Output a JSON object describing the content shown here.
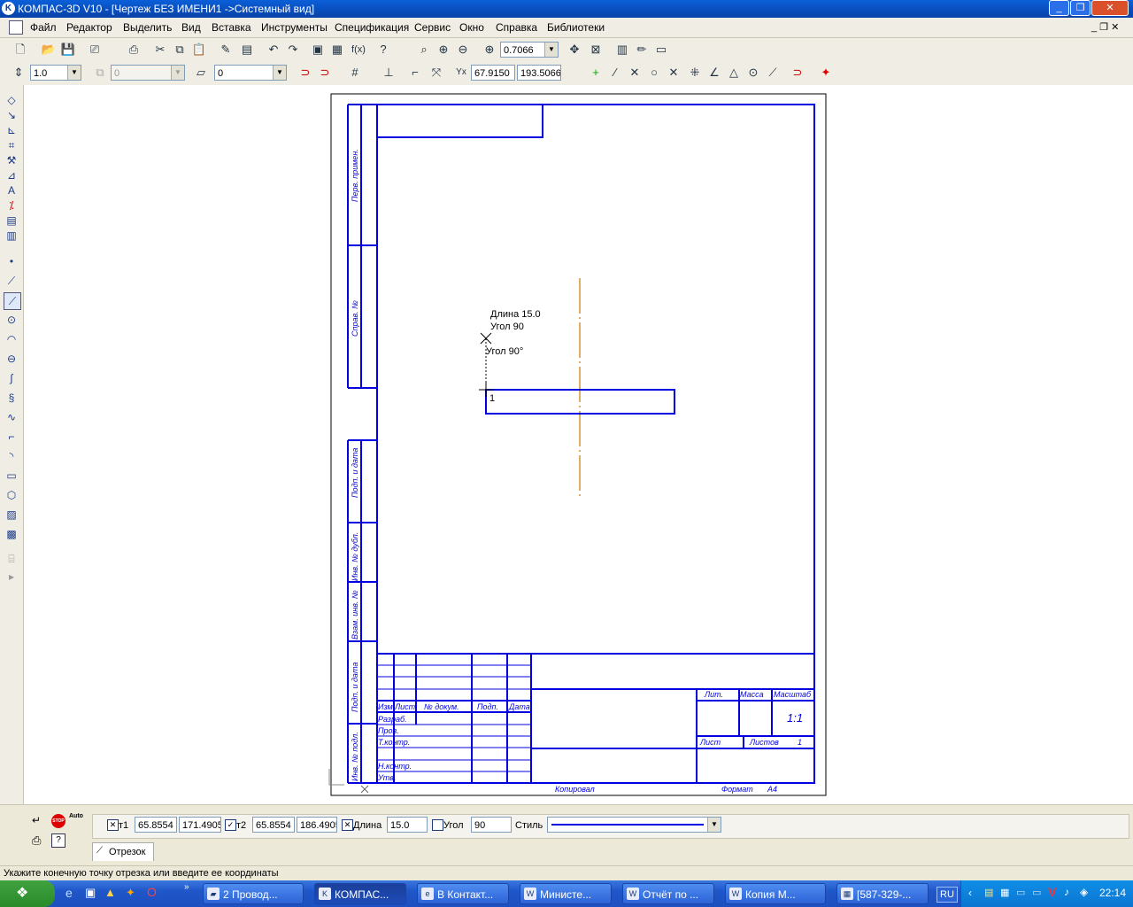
{
  "window": {
    "title": "КОМПАС-3D V10 - [Чертеж БЕЗ ИМЕНИ1 ->Системный вид]"
  },
  "menu": [
    "Файл",
    "Редактор",
    "Выделить",
    "Вид",
    "Вставка",
    "Инструменты",
    "Спецификация",
    "Сервис",
    "Окно",
    "Справка",
    "Библиотеки"
  ],
  "toolbar": {
    "zoom_value": "0.7066",
    "line_step": "1.0",
    "layer_combo": "0",
    "layer_value": "0",
    "coord_x": "67.9150",
    "coord_y": "193.5066"
  },
  "drawing": {
    "stamp_left": [
      "Перв. примен.",
      "Справ. №",
      "Подп. и дата",
      "Инв. № дубл.",
      "Взам. инв. №",
      "Подп. и дата",
      "Инв. № подл."
    ],
    "stamp_headers": [
      "Изм",
      "Лист",
      "№ докум.",
      "Подп.",
      "Дата"
    ],
    "stamp_rows": [
      "Разраб.",
      "Пров.",
      "Т.контр.",
      "Н.контр.",
      "Утв."
    ],
    "stamp_right_headers": [
      "Лит.",
      "Масса",
      "Масштаб"
    ],
    "scale_value": "1:1",
    "sheet_label": "Лист",
    "sheets_label": "Листов",
    "sheets_value": "1",
    "copied_label": "Копировал",
    "format_label": "Формат",
    "format_value": "A4",
    "tooltip_length": "Длина 15.0",
    "tooltip_angle": "Угол 90",
    "angle_hint": "Угол 90°",
    "point_label": "1"
  },
  "params": {
    "t1_label": "т1",
    "t1_x": "65.8554",
    "t1_y": "171.4905",
    "t2_label": "т2",
    "t2_x": "65.8554",
    "t2_y": "186.4905",
    "length_label": "Длина",
    "length_value": "15.0",
    "angle_label": "Угол",
    "angle_value": "90",
    "style_label": "Стиль",
    "tab_label": "Отрезок",
    "auto_label": "Auto",
    "stop_label": "STOP"
  },
  "status": {
    "hint": "Укажите конечную точку отрезка или введите ее координаты"
  },
  "taskbar": {
    "tasks": [
      "2 Провод...",
      "КОМПАС...",
      "В Контакт...",
      "Министе...",
      "Отчёт по ...",
      "Копия М...",
      "[587-329-..."
    ],
    "lang": "RU",
    "clock": "22:14"
  },
  "colors": {
    "frame_blue": "#0000e0",
    "axis_orange": "#c87800",
    "title_blue": "#0842a8"
  }
}
